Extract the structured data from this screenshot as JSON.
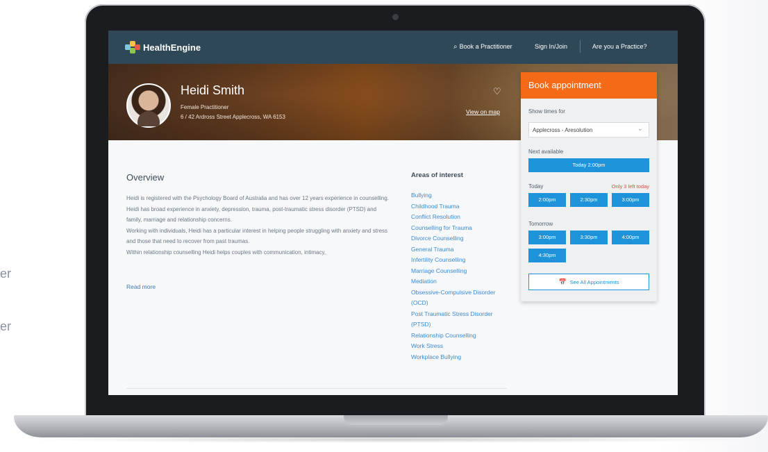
{
  "background_text": {
    "line1": "er",
    "line2": "er"
  },
  "nav": {
    "brand": "HealthEngine",
    "search_label": "Book a Practitioner",
    "signin": "Sign In/Join",
    "practice": "Are you a Practice?"
  },
  "practitioner": {
    "name": "Heidi Smith",
    "type": "Female Practitioner",
    "address": "6 / 42 Ardross Street Applecross, WA 6153",
    "view_map": "View on map"
  },
  "overview": {
    "title": "Overview",
    "paragraphs": [
      "Heidi is registered with the Psychology Board of Australia and has over 12 years experience in counselling.",
      "Heidi has broad experience in anxiety, depression, trauma, post-traumatic stress disorder (PTSD) and family, marriage and relationship concerns.",
      "Working with individuals, Heidi has a particular interest in helping people struggling with anxiety and stress and those that need to recover from past traumas.",
      "Within relationship counselling Heidi helps couples with communication, intimacy,"
    ],
    "read_more": "Read more"
  },
  "areas_of_interest": {
    "title": "Areas of interest",
    "items": [
      "Bullying",
      "Childhood Trauma",
      "Conflict Resolution",
      "Counselling for Trauma",
      "Divorce Counselling",
      "General Trauma",
      "Infertility Counselling",
      "Marriage Counselling",
      "Mediation",
      "Obsessive-Compulsive Disorder (OCD)",
      "Post Traumatic Stress Disorder (PTSD)",
      "Relationship Counselling",
      "Work Stress",
      "Workplace Bullying"
    ]
  },
  "booking": {
    "title": "Book appointment",
    "showtimes_label": "Show times for",
    "location_value": "Applecross - Aresolution",
    "next_label": "Next available",
    "next_slot": "Today 2:00pm",
    "today_label": "Today",
    "only_left": "Only 3 left today",
    "today_slots": [
      "2:00pm",
      "2:30pm",
      "3:00pm"
    ],
    "tomorrow_label": "Tomorrow",
    "tomorrow_slots": [
      "3:00pm",
      "3:30pm",
      "4:00pm",
      "4:30pm"
    ],
    "see_all": "See All Appointments"
  },
  "colors": {
    "nav_bg": "#2f4858",
    "accent_orange": "#f46a16",
    "slot_blue": "#1e93d9",
    "link_blue": "#3b8ad1",
    "alert_red": "#e04a3c"
  },
  "icons": {
    "search": "magnifier",
    "favorite": "heart-outline",
    "dropdown": "chevron-down",
    "calendar": "calendar"
  }
}
